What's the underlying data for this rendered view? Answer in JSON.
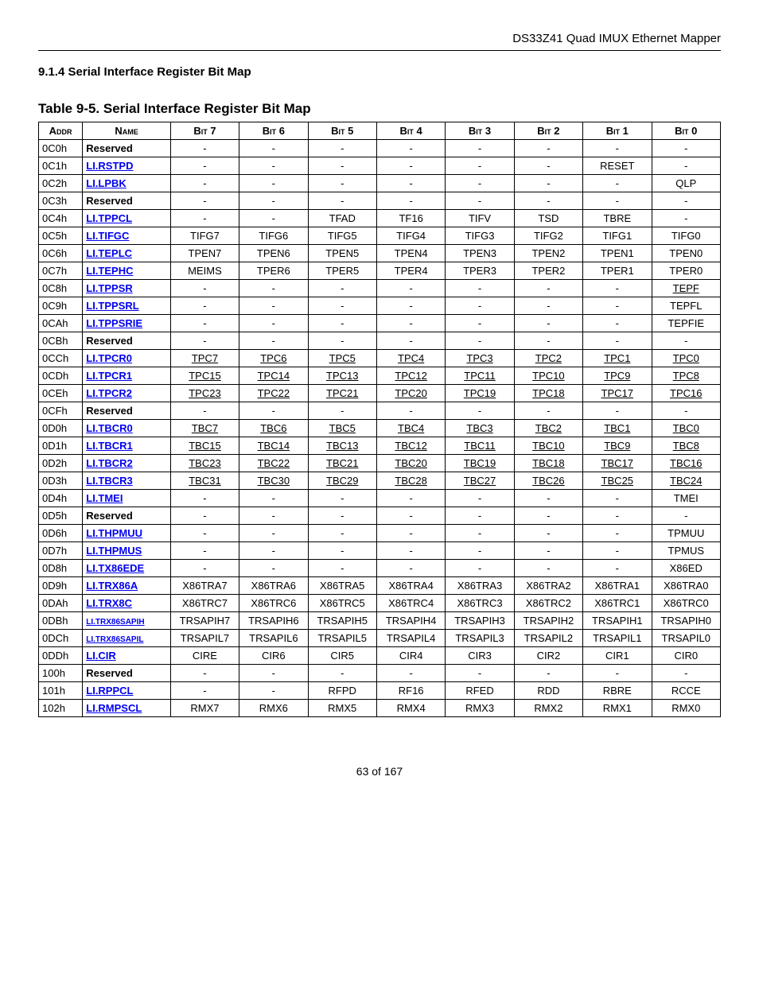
{
  "doc_header": "DS33Z41 Quad IMUX Ethernet Mapper",
  "section": "9.1.4   Serial Interface Register Bit Map",
  "table_title": "Table 9-5. Serial Interface Register Bit Map",
  "footer": "63 of 167",
  "columns": [
    "Addr",
    "Name",
    "Bit 7",
    "Bit 6",
    "Bit 5",
    "Bit 4",
    "Bit 3",
    "Bit 2",
    "Bit 1",
    "Bit 0"
  ],
  "chart_data": {
    "type": "table",
    "title": "Serial Interface Register Bit Map",
    "headers": [
      "Addr",
      "Name",
      "Bit 7",
      "Bit 6",
      "Bit 5",
      "Bit 4",
      "Bit 3",
      "Bit 2",
      "Bit 1",
      "Bit 0"
    ],
    "rows": [
      {
        "addr": "0C0h",
        "name": "Reserved",
        "link": false,
        "bits": [
          "-",
          "-",
          "-",
          "-",
          "-",
          "-",
          "-",
          "-"
        ],
        "ul": []
      },
      {
        "addr": "0C1h",
        "name": "LI.RSTPD",
        "link": true,
        "bits": [
          "-",
          "-",
          "-",
          "-",
          "-",
          "-",
          "RESET",
          "-"
        ],
        "ul": []
      },
      {
        "addr": "0C2h",
        "name": "LI.LPBK",
        "link": true,
        "bits": [
          "-",
          "-",
          "-",
          "-",
          "-",
          "-",
          "-",
          "QLP"
        ],
        "ul": []
      },
      {
        "addr": "0C3h",
        "name": "Reserved",
        "link": false,
        "bits": [
          "-",
          "-",
          "-",
          "-",
          "-",
          "-",
          "-",
          "-"
        ],
        "ul": []
      },
      {
        "addr": "0C4h",
        "name": "LI.TPPCL",
        "link": true,
        "bits": [
          "-",
          "-",
          "TFAD",
          "TF16",
          "TIFV",
          "TSD",
          "TBRE",
          "-"
        ],
        "ul": []
      },
      {
        "addr": "0C5h",
        "name": "LI.TIFGC",
        "link": true,
        "bits": [
          "TIFG7",
          "TIFG6",
          "TIFG5",
          "TIFG4",
          "TIFG3",
          "TIFG2",
          "TIFG1",
          "TIFG0"
        ],
        "ul": []
      },
      {
        "addr": "0C6h",
        "name": "LI.TEPLC",
        "link": true,
        "bits": [
          "TPEN7",
          "TPEN6",
          "TPEN5",
          "TPEN4",
          "TPEN3",
          "TPEN2",
          "TPEN1",
          "TPEN0"
        ],
        "ul": []
      },
      {
        "addr": "0C7h",
        "name": "LI.TEPHC",
        "link": true,
        "bits": [
          "MEIMS",
          "TPER6",
          "TPER5",
          "TPER4",
          "TPER3",
          "TPER2",
          "TPER1",
          "TPER0"
        ],
        "ul": []
      },
      {
        "addr": "0C8h",
        "name": "LI.TPPSR",
        "link": true,
        "bits": [
          "-",
          "-",
          "-",
          "-",
          "-",
          "-",
          "-",
          "TEPF"
        ],
        "ul": [
          7
        ]
      },
      {
        "addr": "0C9h",
        "name": "LI.TPPSRL",
        "link": true,
        "bits": [
          "-",
          "-",
          "-",
          "-",
          "-",
          "-",
          "-",
          "TEPFL"
        ],
        "ul": []
      },
      {
        "addr": "0CAh",
        "name": "LI.TPPSRIE",
        "link": true,
        "bits": [
          "-",
          "-",
          "-",
          "-",
          "-",
          "-",
          "-",
          "TEPFIE"
        ],
        "ul": []
      },
      {
        "addr": "0CBh",
        "name": "Reserved",
        "link": false,
        "bits": [
          "-",
          "-",
          "-",
          "-",
          "-",
          "-",
          "-",
          "-"
        ],
        "ul": []
      },
      {
        "addr": "0CCh",
        "name": "LI.TPCR0",
        "link": true,
        "bits": [
          "TPC7",
          "TPC6",
          "TPC5",
          "TPC4",
          "TPC3",
          "TPC2",
          "TPC1",
          "TPC0"
        ],
        "ul": [
          0,
          1,
          2,
          3,
          4,
          5,
          6,
          7
        ]
      },
      {
        "addr": "0CDh",
        "name": "LI.TPCR1",
        "link": true,
        "bits": [
          "TPC15",
          "TPC14",
          "TPC13",
          "TPC12",
          "TPC11",
          "TPC10",
          "TPC9",
          "TPC8"
        ],
        "ul": [
          0,
          1,
          2,
          3,
          4,
          5,
          6,
          7
        ]
      },
      {
        "addr": "0CEh",
        "name": "LI.TPCR2",
        "link": true,
        "bits": [
          "TPC23",
          "TPC22",
          "TPC21",
          "TPC20",
          "TPC19",
          "TPC18",
          "TPC17",
          "TPC16"
        ],
        "ul": [
          0,
          1,
          2,
          3,
          4,
          5,
          6,
          7
        ]
      },
      {
        "addr": "0CFh",
        "name": "Reserved",
        "link": false,
        "bits": [
          "-",
          "-",
          "-",
          "-",
          "-",
          "-",
          "-",
          "-"
        ],
        "ul": []
      },
      {
        "addr": "0D0h",
        "name": "LI.TBCR0",
        "link": true,
        "bits": [
          "TBC7",
          "TBC6",
          "TBC5",
          "TBC4",
          "TBC3",
          "TBC2",
          "TBC1",
          "TBC0"
        ],
        "ul": [
          0,
          1,
          2,
          3,
          4,
          5,
          6,
          7
        ]
      },
      {
        "addr": "0D1h",
        "name": "LI.TBCR1",
        "link": true,
        "bits": [
          "TBC15",
          "TBC14",
          "TBC13",
          "TBC12",
          "TBC11",
          "TBC10",
          "TBC9",
          "TBC8"
        ],
        "ul": [
          0,
          1,
          2,
          3,
          4,
          5,
          6,
          7
        ]
      },
      {
        "addr": "0D2h",
        "name": "LI.TBCR2",
        "link": true,
        "bits": [
          "TBC23",
          "TBC22",
          "TBC21",
          "TBC20",
          "TBC19",
          "TBC18",
          "TBC17",
          "TBC16"
        ],
        "ul": [
          0,
          1,
          2,
          3,
          4,
          5,
          6,
          7
        ]
      },
      {
        "addr": "0D3h",
        "name": "LI.TBCR3",
        "link": true,
        "bits": [
          "TBC31",
          "TBC30",
          "TBC29",
          "TBC28",
          "TBC27",
          "TBC26",
          "TBC25",
          "TBC24"
        ],
        "ul": [
          0,
          1,
          2,
          3,
          4,
          5,
          6,
          7
        ]
      },
      {
        "addr": "0D4h",
        "name": "LI.TMEI",
        "link": true,
        "bits": [
          "-",
          "-",
          "-",
          "-",
          "-",
          "-",
          "-",
          "TMEI"
        ],
        "ul": []
      },
      {
        "addr": "0D5h",
        "name": "Reserved",
        "link": false,
        "bits": [
          "-",
          "-",
          "-",
          "-",
          "-",
          "-",
          "-",
          "-"
        ],
        "ul": []
      },
      {
        "addr": "0D6h",
        "name": "LI.THPMUU",
        "link": true,
        "bits": [
          "-",
          "-",
          "-",
          "-",
          "-",
          "-",
          "-",
          "TPMUU"
        ],
        "ul": []
      },
      {
        "addr": "0D7h",
        "name": "LI.THPMUS",
        "link": true,
        "bits": [
          "-",
          "-",
          "-",
          "-",
          "-",
          "-",
          "-",
          "TPMUS"
        ],
        "ul": []
      },
      {
        "addr": "0D8h",
        "name": "LI.TX86EDE",
        "link": true,
        "bits": [
          "-",
          "-",
          "-",
          "-",
          "-",
          "-",
          "-",
          "X86ED"
        ],
        "ul": []
      },
      {
        "addr": "0D9h",
        "name": "LI.TRX86A",
        "link": true,
        "bits": [
          "X86TRA7",
          "X86TRA6",
          "X86TRA5",
          "X86TRA4",
          "X86TRA3",
          "X86TRA2",
          "X86TRA1",
          "X86TRA0"
        ],
        "ul": []
      },
      {
        "addr": "0DAh",
        "name": "LI.TRX8C",
        "link": true,
        "bits": [
          "X86TRC7",
          "X86TRC6",
          "X86TRC5",
          "X86TRC4",
          "X86TRC3",
          "X86TRC2",
          "X86TRC1",
          "X86TRC0"
        ],
        "ul": []
      },
      {
        "addr": "0DBh",
        "name": "LI.TRX86SAPIH",
        "link": true,
        "small": true,
        "bits": [
          "TRSAPIH7",
          "TRSAPIH6",
          "TRSAPIH5",
          "TRSAPIH4",
          "TRSAPIH3",
          "TRSAPIH2",
          "TRSAPIH1",
          "TRSAPIH0"
        ],
        "ul": []
      },
      {
        "addr": "0DCh",
        "name": "LI.TRX86SAPIL",
        "link": true,
        "small": true,
        "bits": [
          "TRSAPIL7",
          "TRSAPIL6",
          "TRSAPIL5",
          "TRSAPIL4",
          "TRSAPIL3",
          "TRSAPIL2",
          "TRSAPIL1",
          "TRSAPIL0"
        ],
        "ul": []
      },
      {
        "addr": "0DDh",
        "name": "LI.CIR",
        "link": true,
        "bits": [
          "CIRE",
          "CIR6",
          "CIR5",
          "CIR4",
          "CIR3",
          "CIR2",
          "CIR1",
          "CIR0"
        ],
        "ul": []
      },
      {
        "addr": "100h",
        "name": "Reserved",
        "link": false,
        "bits": [
          "-",
          "-",
          "-",
          "-",
          "-",
          "-",
          "-",
          "-"
        ],
        "ul": []
      },
      {
        "addr": "101h",
        "name": "LI.RPPCL",
        "link": true,
        "bits": [
          "-",
          "-",
          "RFPD",
          "RF16",
          "RFED",
          "RDD",
          "RBRE",
          "RCCE"
        ],
        "ul": []
      },
      {
        "addr": "102h",
        "name": "LI.RMPSCL",
        "link": true,
        "bits": [
          "RMX7",
          "RMX6",
          "RMX5",
          "RMX4",
          "RMX3",
          "RMX2",
          "RMX1",
          "RMX0"
        ],
        "ul": []
      }
    ]
  }
}
